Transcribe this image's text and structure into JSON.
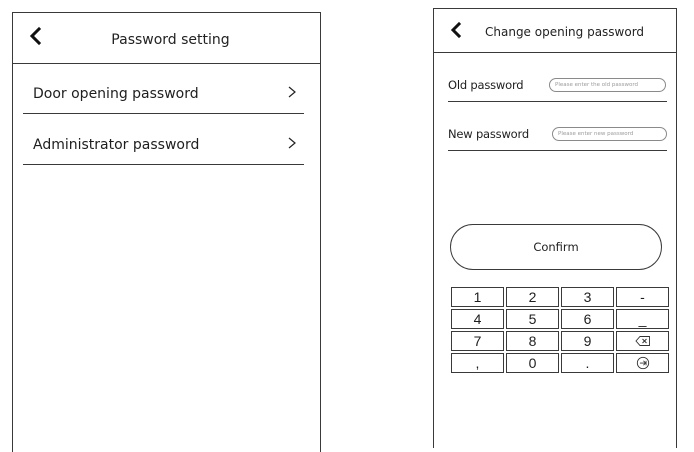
{
  "left_screen": {
    "title": "Password setting",
    "back_icon": "chevron-left-icon",
    "menu": [
      {
        "label": "Door opening password",
        "icon": "chevron-right-icon"
      },
      {
        "label": "Administrator password",
        "icon": "chevron-right-icon"
      }
    ]
  },
  "right_screen": {
    "title": "Change opening password",
    "back_icon": "chevron-left-icon",
    "old_password": {
      "label": "Old password",
      "placeholder": "Please enter the old password"
    },
    "new_password": {
      "label": "New password",
      "placeholder": "Please enter new password"
    },
    "confirm_label": "Confirm",
    "keypad": {
      "row1": [
        "1",
        "2",
        "3",
        "-"
      ],
      "row2": [
        "4",
        "5",
        "6",
        "_"
      ],
      "row3": [
        "7",
        "8",
        "9"
      ],
      "row4": [
        ",",
        "0",
        "."
      ],
      "backspace_icon": "backspace-icon",
      "enter_icon": "enter-icon"
    }
  }
}
